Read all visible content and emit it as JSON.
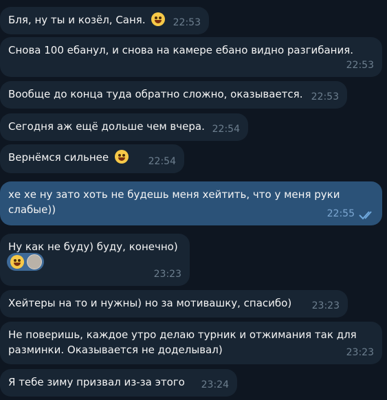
{
  "messages": [
    {
      "text": "Бля, ну ты и козёл, Саня.",
      "time": "22:53",
      "emoji": "rofl"
    },
    {
      "text": "Снова 100 ебанул, и снова на камере ебано видно разгибания.",
      "time": "22:53"
    },
    {
      "text": "Вообще до конца туда обратно сложно, оказывается.",
      "time": "22:53"
    },
    {
      "text": "Сегодня аж ещё дольше чем вчера.",
      "time": "22:54"
    },
    {
      "text": "Вернёмся сильнее",
      "time": "22:54",
      "emoji": "rofl"
    },
    {
      "text": "хе хе ну зато хоть не будешь меня хейтить, что у меня руки слабые))",
      "time": "22:55",
      "outgoing": true,
      "status": "read-double-check"
    },
    {
      "text": "Ну как не буду) буду, конечно)",
      "time": "23:23",
      "reaction": {
        "emoji": "grinning-face",
        "avatar": "user-avatar"
      }
    },
    {
      "text": "Хейтеры на то и нужны) но за мотивашку, спасибо)",
      "time": "23:23"
    },
    {
      "text": "Не поверишь, каждое утро делаю турник и отжимания так для разминки. Оказывается не доделывал)",
      "time": "23:23"
    },
    {
      "text": "Я тебе зиму призвал из-за этого",
      "time": "23:24"
    }
  ]
}
